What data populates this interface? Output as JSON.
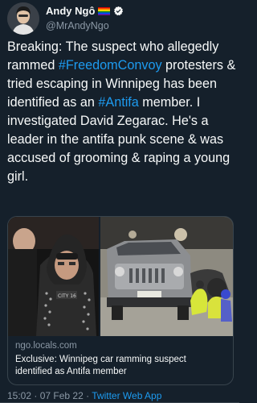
{
  "author": {
    "display_name": "Andy Ngô",
    "handle": "@MrAndyNgo",
    "flag_emoji": "rainbow-flag",
    "verified": true,
    "avatar": "avatar"
  },
  "tweet": {
    "segments": [
      {
        "text": "Breaking: The suspect who allegedly rammed ",
        "type": "text"
      },
      {
        "text": "#FreedomConvoy",
        "type": "hashtag"
      },
      {
        "text": " protesters & tried escaping in Winnipeg has been identified as an ",
        "type": "text"
      },
      {
        "text": "#Antifa",
        "type": "hashtag"
      },
      {
        "text": " member. I investigated David Zegarac. He's a leader in the antifa punk scene & was accused of grooming & raping a young girl.",
        "type": "text"
      }
    ]
  },
  "card": {
    "domain": "ngo.locals.com",
    "title": "Exclusive: Winnipeg car ramming suspect identified as Antifa member",
    "left_image": "portrait-photo",
    "right_image": "car-crash-scene-photo"
  },
  "meta": {
    "time": "15:02",
    "separator": "·",
    "date": "07 Feb 22",
    "client": "Twitter Web App"
  },
  "colors": {
    "background": "#15202b",
    "text": "#f7f9f9",
    "secondary": "#8b98a5",
    "accent": "#1d9bf0",
    "border": "#38444d"
  }
}
